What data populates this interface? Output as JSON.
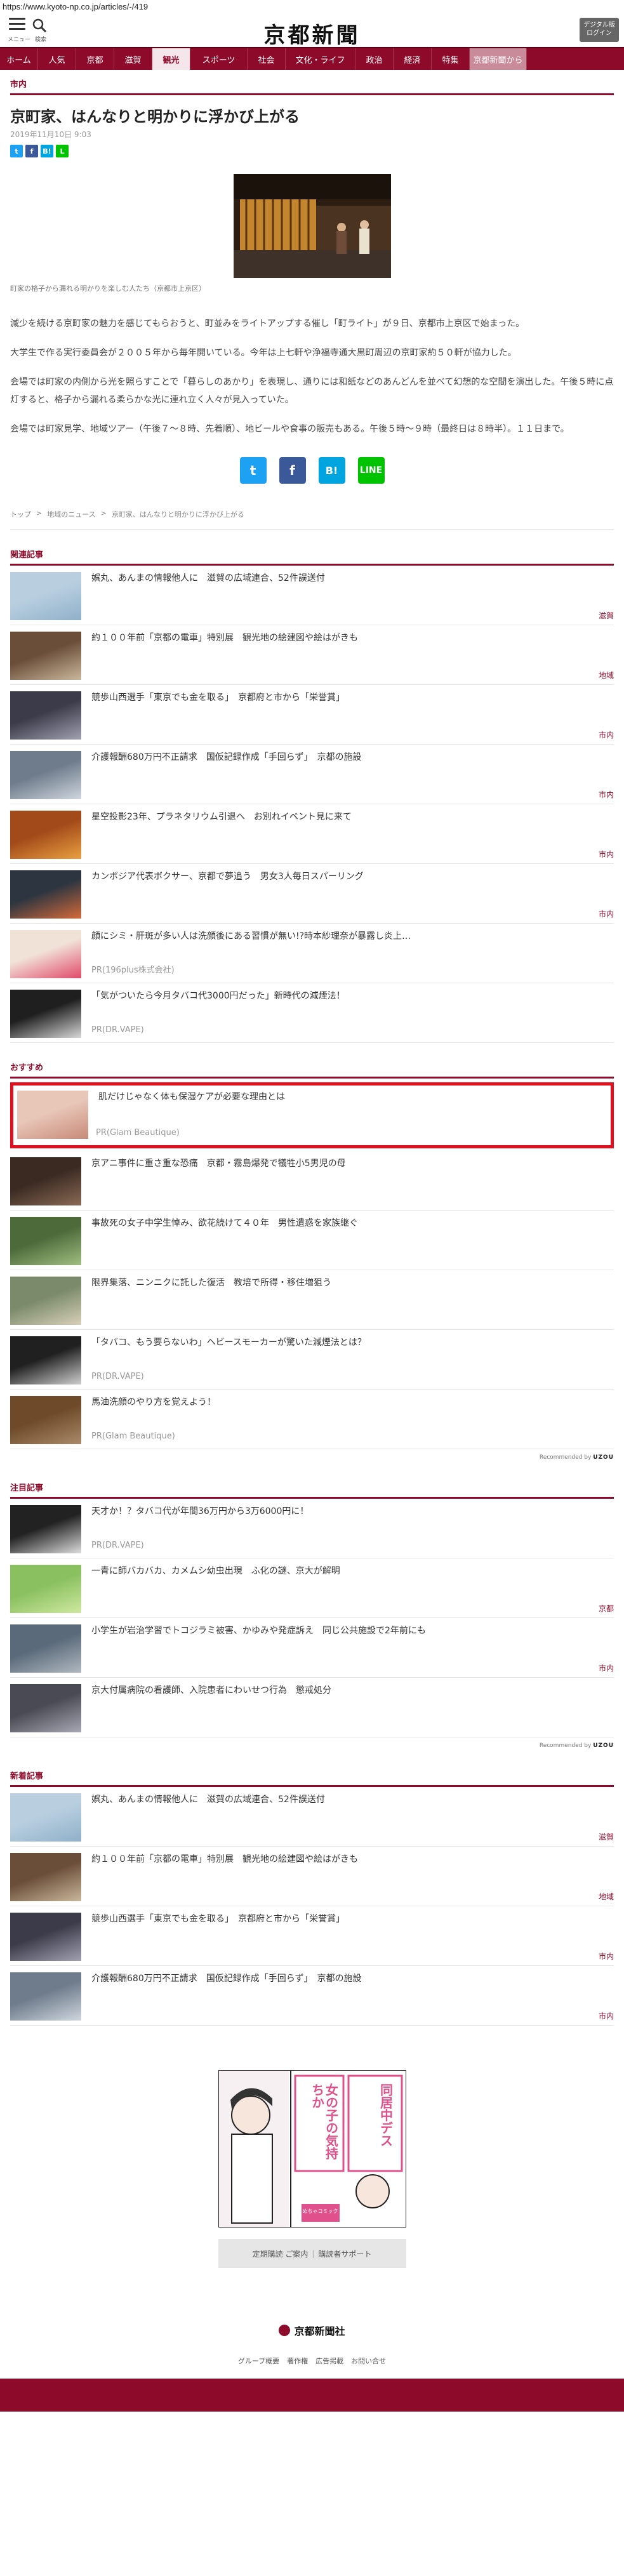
{
  "url": "https://www.kyoto-np.co.jp/articles/-/419",
  "header": {
    "menu_label": "メニュー",
    "search_label": "検索",
    "brand": "京都新聞",
    "login": "デジタル版\nログイン"
  },
  "nav": [
    "ホーム",
    "人気",
    "京都",
    "滋賀",
    "観光",
    "スポーツ",
    "社会",
    "文化・ライフ",
    "政治",
    "経済",
    "特集",
    "京都新聞から"
  ],
  "nav_active": "観光",
  "article": {
    "section": "市内",
    "title": "京町家、はんなりと明かりに浮かび上がる",
    "date": "2019年11月10日 9:03",
    "caption": "町家の格子から漏れる明かりを楽しむ人たち（京都市上京区）",
    "paragraphs": [
      "減少を続ける京町家の魅力を感じてもらおうと、町並みをライトアップする催し「町ライト」が９日、京都市上京区で始まった。",
      "大学生で作る実行委員会が２００５年から毎年開いている。今年は上七軒や浄福寺通大黒町周辺の京町家約５０軒が協力した。",
      "会場では町家の内側から光を照らすことで「暮らしのあかり」を表現し、通りには和紙などのあんどんを並べて幻想的な空間を演出した。午後５時に点灯すると、格子から漏れる柔らかな光に連れ立く人々が見入っていた。",
      "会場では町家見学、地域ツアー（午後７～８時、先着順）、地ビールや食事の販売もある。午後５時～９時（最終日は８時半）。１１日まで。"
    ],
    "breadcrumb": [
      "トップ",
      "地域のニュース",
      "京町家、はんなりと明かりに浮かび上がる"
    ]
  },
  "related": {
    "title": "関連記事",
    "items": [
      {
        "text": "娯丸、あんまの情報他人に　滋賀の広域連合、52件誤送付",
        "tag": "滋賀"
      },
      {
        "text": "約１００年前「京都の電車」特別展　観光地の絵建図や絵はがきも",
        "tag": "地域"
      },
      {
        "text": "競歩山西選手「東京でも金を取る」　京都府と市から「栄誉賞」",
        "tag": "市内"
      },
      {
        "text": "介護報酬680万円不正請求　国仮記録作成「手回らず」　京都の施設",
        "tag": "市内"
      },
      {
        "text": "星空投影23年、プラネタリウム引退へ　お別れイベント見に来て",
        "tag": "市内"
      },
      {
        "text": "カンボジア代表ボクサー、京都で夢追う　男女3人毎日スパーリング",
        "tag": "市内"
      },
      {
        "text": "顔にシミ・肝斑が多い人は洗顔後にある習慣が無い!?時本紗理奈が暴露し炎上…",
        "pr": "PR(196plus株式会社)"
      },
      {
        "text": "「気がついたら今月タバコ代3000円だった」新時代の減煙法！",
        "pr": "PR(DR.VAPE)"
      }
    ]
  },
  "recommend": {
    "title": "おすすめ",
    "items": [
      {
        "text": "肌だけじゃなく体も保湿ケアが必要な理由とは",
        "pr": "PR(Glam Beautique)"
      },
      {
        "text": "京アニ事件に重さ重な恐痛　京都・霧島爆発で犠牲小5男児の母"
      },
      {
        "text": "事故死の女子中学生悼み、欲花続けて４０年　男性遺惑を家族継ぐ"
      },
      {
        "text": "限界集落、ニンニクに託した復活　教培で所得・移住増狙う"
      },
      {
        "text": "「タバコ、もう要らないわ」ヘビースモーカーが驚いた減煙法とは？",
        "pr": "PR(DR.VAPE)"
      },
      {
        "text": "馬油洗顔のやり方を覚えよう！",
        "pr": "PR(Glam Beautique)"
      }
    ],
    "recommended_by": "Recommended by",
    "brand": "UZOU"
  },
  "featured": {
    "title": "注目記事",
    "items": [
      {
        "text": "天才か！？タバコ代が年間36万円から3万6000円に！",
        "pr": "PR(DR.VAPE)"
      },
      {
        "text": "一青に師バカバカ、カメムシ幼虫出現　ふ化の謎、京大が解明",
        "tag": "京都"
      },
      {
        "text": "小学生が岩治学習でトコジラミ被害、かゆみや発症訴え　同じ公共施設で2年前にも",
        "tag": "市内"
      },
      {
        "text": "京大付属病院の看護師、入院患者にわいせつ行為　懲戒処分"
      }
    ],
    "recommended_by": "Recommended by",
    "brand": "UZOU"
  },
  "latest": {
    "title": "新着記事",
    "items": [
      {
        "text": "娯丸、あんまの情報他人に　滋賀の広域連合、52件誤送付",
        "tag": "滋賀"
      },
      {
        "text": "約１００年前「京都の電車」特別展　観光地の絵建図や絵はがきも",
        "tag": "地域"
      },
      {
        "text": "競歩山西選手「東京でも金を取る」　京都府と市から「栄誉賞」",
        "tag": "市内"
      },
      {
        "text": "介護報酬680万円不正請求　国仮記録作成「手回らず」　京都の施設",
        "tag": "市内"
      }
    ]
  },
  "ad": {
    "text_a": "女の子の気持ちか",
    "text_b": "同居中デス",
    "badge": "めちゃコミック"
  },
  "subscribe": [
    "定期購読 ご案内",
    "購読者サポート"
  ],
  "footer": {
    "logo": "京都新聞社",
    "links": [
      "グループ概要",
      "著作権",
      "広告掲載",
      "お問い合せ"
    ]
  },
  "colors": {
    "brand": "#8e0a2a",
    "highlight_border": "#e0101f",
    "twitter": "#1da1f2",
    "facebook": "#3b5998",
    "hatena": "#00a4de",
    "line": "#00c300"
  }
}
